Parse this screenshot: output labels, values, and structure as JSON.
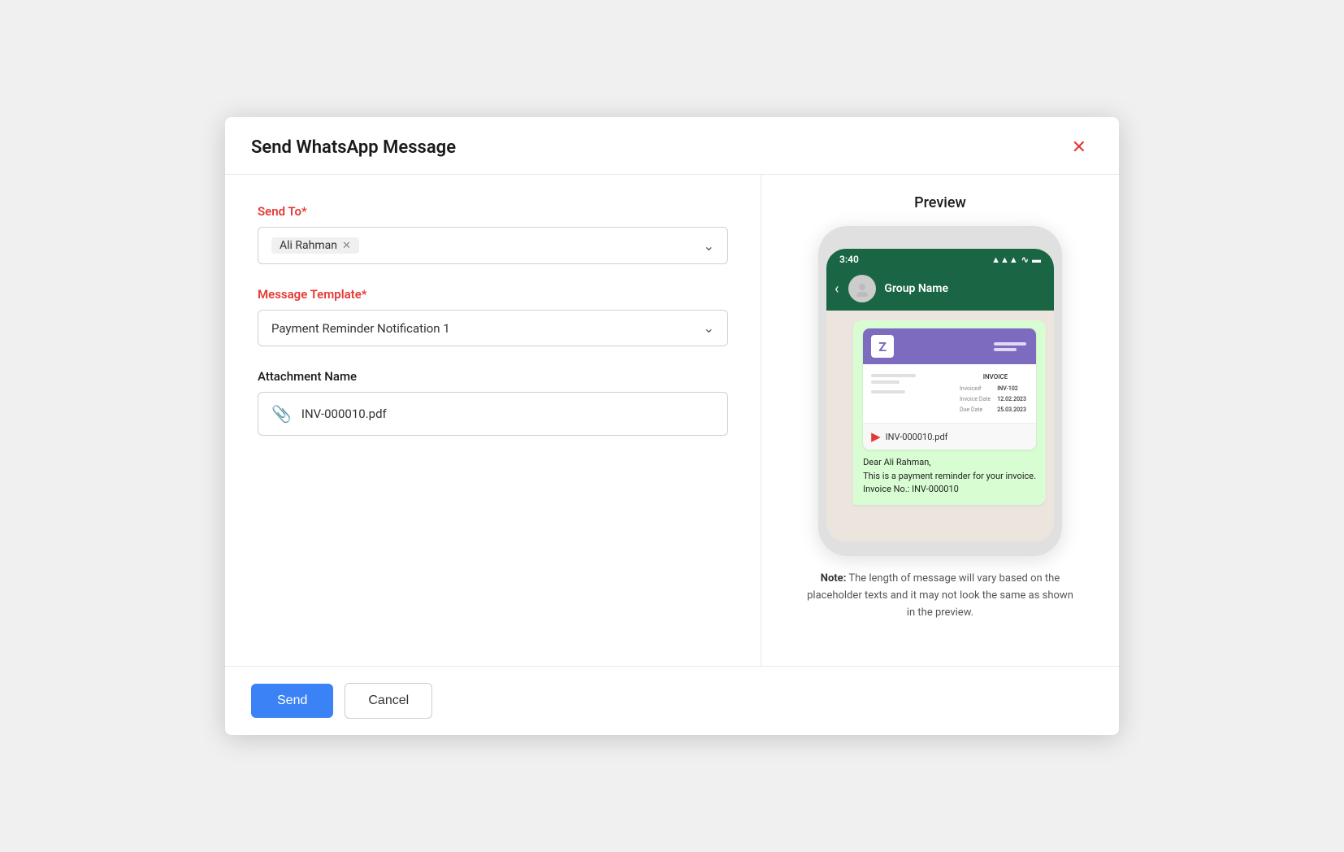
{
  "dialog": {
    "title": "Send WhatsApp Message",
    "close_label": "✕"
  },
  "form": {
    "send_to_label": "Send To*",
    "recipient_tag": "Ali Rahman",
    "message_template_label": "Message Template*",
    "template_value": "Payment Reminder Notification 1",
    "attachment_name_label": "Attachment Name",
    "attachment_value": "INV-000010.pdf"
  },
  "preview": {
    "title": "Preview",
    "phone": {
      "status_time": "3:40",
      "status_icons": "▲▲ ⊙ ▬",
      "group_name": "Group Name",
      "invoice_title": "INVOICE",
      "invoice_number_label": "Invoice#",
      "invoice_number_value": "INV-102",
      "invoice_date_label": "Invoice Date",
      "invoice_date_value": "12.02.2023",
      "due_date_label": "Due Date",
      "due_date_value": "25.03.2023",
      "pdf_filename": "INV-000010.pdf",
      "message_line1": "Dear Ali Rahman,",
      "message_line2": "This is a payment reminder for your invoice.",
      "message_line3": "Invoice No.: INV-000010"
    },
    "note": "Note: The length of message will vary based on the placeholder texts and it may not look the same as shown in the preview."
  },
  "footer": {
    "send_label": "Send",
    "cancel_label": "Cancel"
  }
}
